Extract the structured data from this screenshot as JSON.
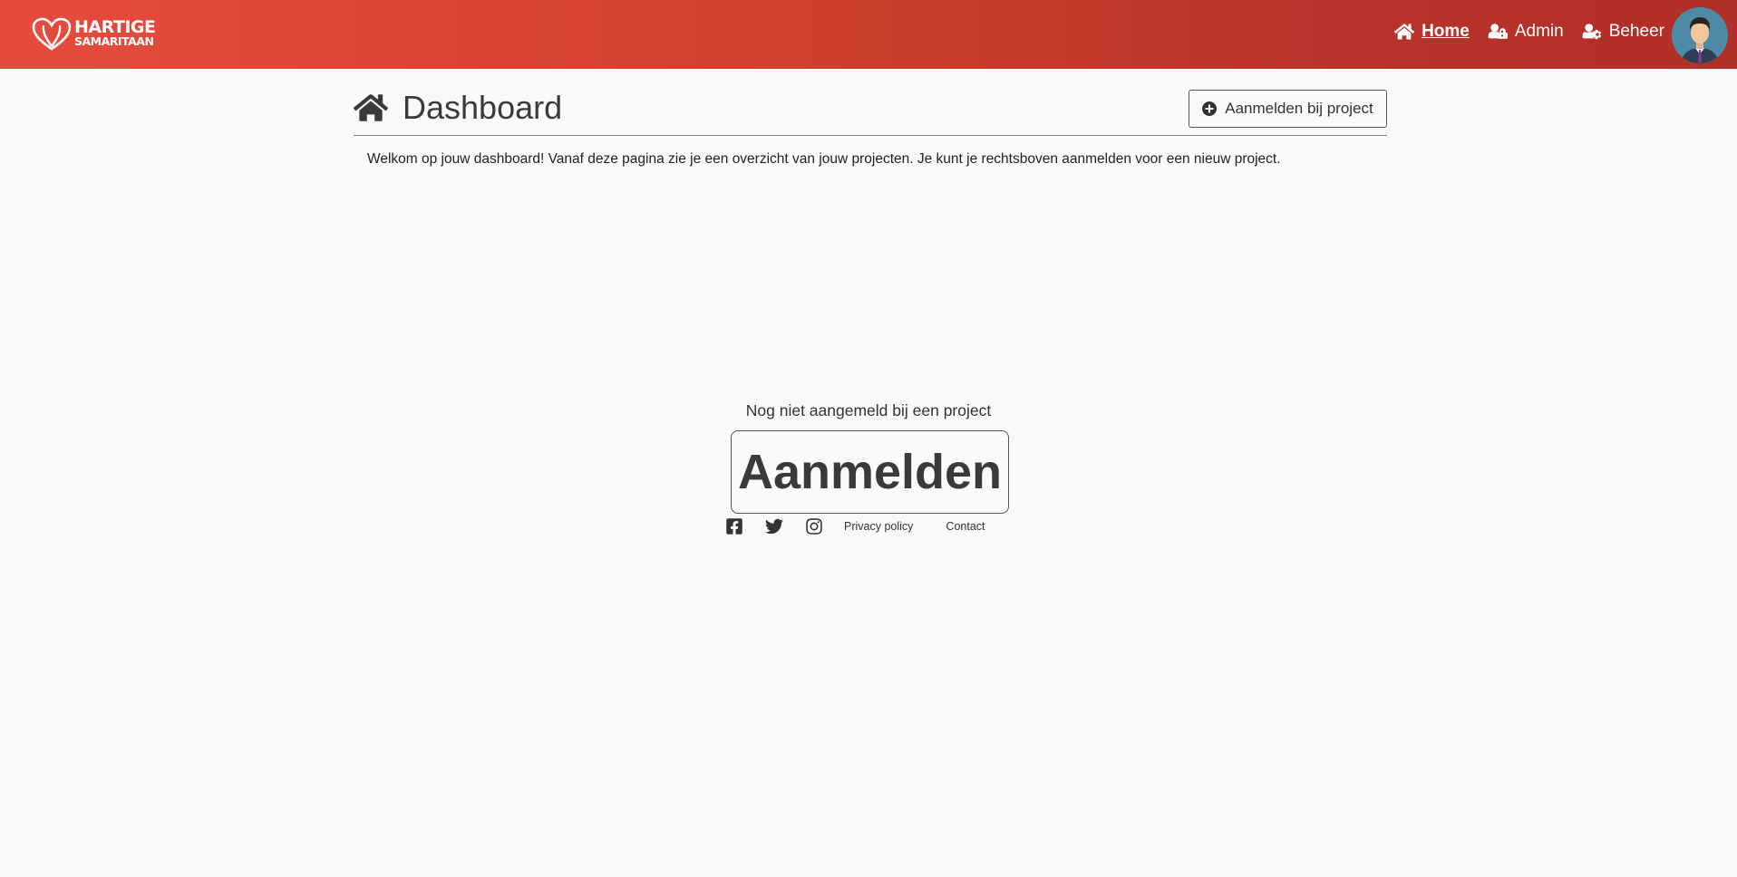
{
  "brand": {
    "line1": "HARTIGE",
    "line2": "SAMARITAAN",
    "primary_color": "#e64c3e",
    "secondary_color": "#b02f28"
  },
  "nav": {
    "items": [
      {
        "label": "Home",
        "icon": "home-icon",
        "active": true
      },
      {
        "label": "Admin",
        "icon": "user-lock-icon",
        "active": false
      },
      {
        "label": "Beheer",
        "icon": "user-cog-icon",
        "active": false
      }
    ]
  },
  "page": {
    "title": "Dashboard",
    "join_button": "Aanmelden bij project",
    "welcome": "Welkom op jouw dashboard! Vanaf deze pagina zie je een overzicht van jouw projecten. Je kunt je rechtsboven aanmelden voor een nieuw project."
  },
  "empty_state": {
    "message": "Nog niet aangemeld bij een project",
    "button": "Aanmelden"
  },
  "footer": {
    "privacy": "Privacy policy",
    "contact": "Contact",
    "social": [
      "facebook-icon",
      "twitter-icon",
      "instagram-icon"
    ]
  }
}
